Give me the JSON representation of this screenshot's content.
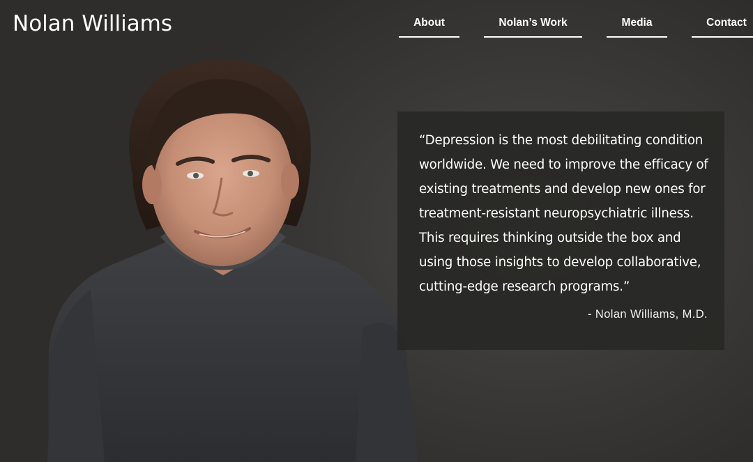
{
  "header": {
    "site_title": "Nolan Williams"
  },
  "nav": {
    "items": [
      {
        "label": "About"
      },
      {
        "label": "Nolan’s Work"
      },
      {
        "label": "Media"
      },
      {
        "label": "Contact"
      }
    ]
  },
  "hero": {
    "quote_lines": [
      "“Depression is the most debilitating condition",
      "worldwide. We need to improve the efficacy of",
      "existing treatments and develop new ones for",
      "treatment-resistant neuropsychiatric illness.",
      "This requires thinking outside the box and",
      "using those insights to develop collaborative,",
      "cutting-edge research programs.”"
    ],
    "attribution": "- Nolan Williams, M.D."
  },
  "colors": {
    "background": "#2f2e2c",
    "quote_card": "#282826",
    "text": "#ffffff"
  }
}
